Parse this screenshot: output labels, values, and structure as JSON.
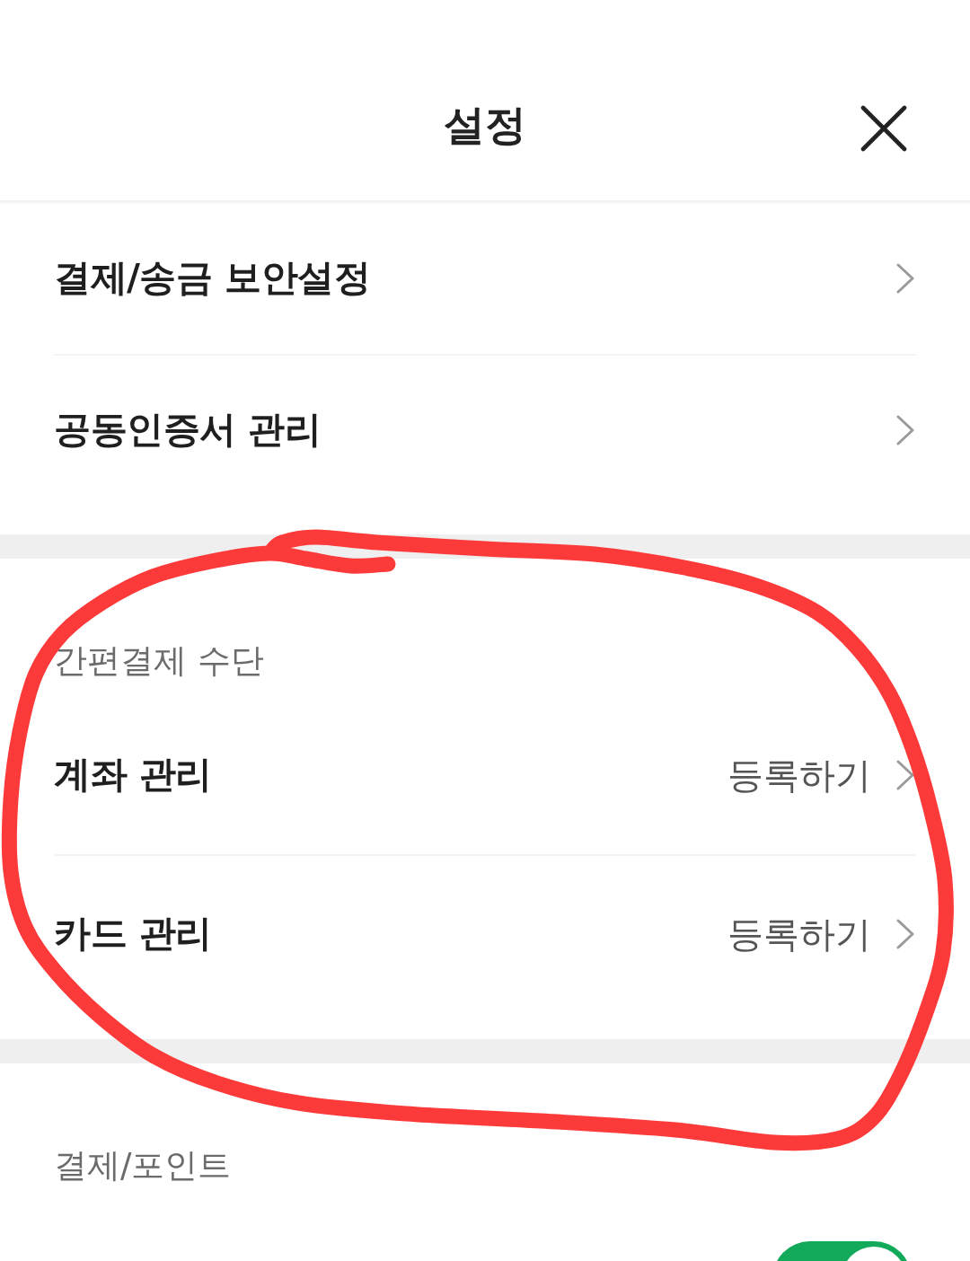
{
  "header": {
    "title": "설정"
  },
  "sections": [
    {
      "items": [
        {
          "kind": "link",
          "label": "결제/송금 보안설정"
        },
        {
          "kind": "link",
          "label": "공동인증서 관리"
        }
      ]
    },
    {
      "heading": "간편결제 수단",
      "items": [
        {
          "kind": "link",
          "label": "계좌 관리",
          "value": "등록하기"
        },
        {
          "kind": "link",
          "label": "카드 관리",
          "value": "등록하기"
        }
      ]
    },
    {
      "heading": "결제/포인트",
      "items": [
        {
          "kind": "toggle",
          "on": true
        }
      ]
    }
  ],
  "annotation": {
    "kind": "loop"
  }
}
